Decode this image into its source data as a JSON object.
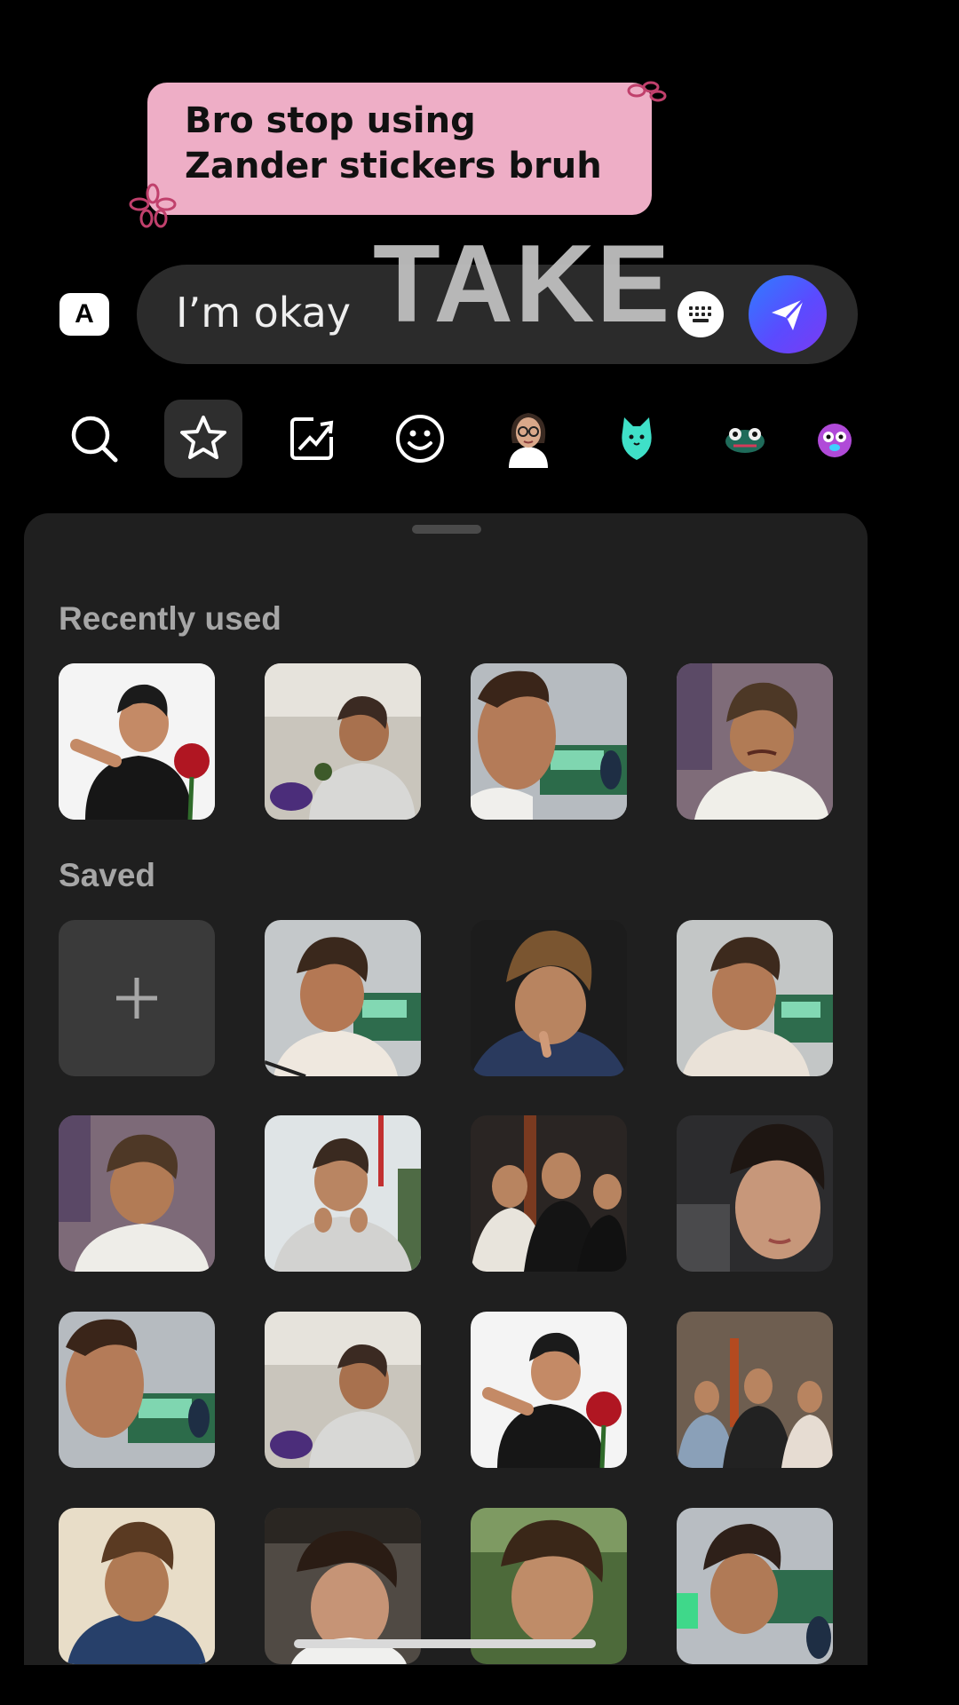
{
  "sticker_text": "Bro stop using Zander stickers bruh",
  "overlay_text": "TAKE",
  "composer": {
    "mode_button": "A",
    "input_value": "I’m okay"
  },
  "categories": [
    {
      "name": "search-icon",
      "selected": false
    },
    {
      "name": "star-icon",
      "selected": true
    },
    {
      "name": "trending-icon",
      "selected": false
    },
    {
      "name": "smiley-icon",
      "selected": false
    },
    {
      "name": "avatar-sticker-icon",
      "selected": false
    },
    {
      "name": "cyan-cat-sticker-icon",
      "selected": false
    },
    {
      "name": "frog-sticker-icon",
      "selected": false
    },
    {
      "name": "purple-creature-sticker-icon",
      "selected": false
    }
  ],
  "panel": {
    "recently_used_title": "Recently used",
    "saved_title": "Saved",
    "add_symbol": "+"
  },
  "colors": {
    "background": "#000000",
    "panel": "#1f1f1f",
    "sticker_pink": "#eeaec6",
    "send_gradient_start": "#2f7dff",
    "send_gradient_end": "#7a3bf2"
  }
}
